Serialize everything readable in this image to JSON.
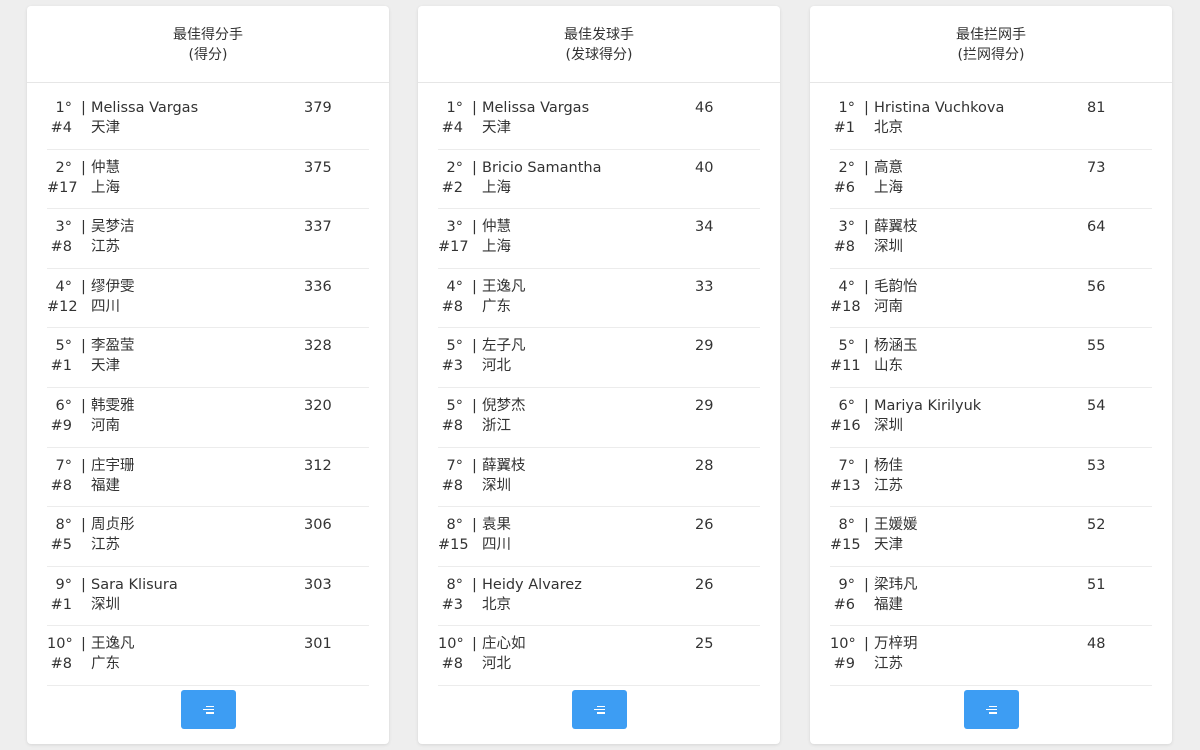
{
  "accent_color": "#3d9df3",
  "panels": [
    {
      "title": "最佳得分手",
      "subtitle": "(得分)",
      "more_icon": "list-icon",
      "rows": [
        {
          "rank": "1°",
          "sep": "|",
          "name": "Melissa Vargas",
          "seed": "#4",
          "city": "天津",
          "value": "379"
        },
        {
          "rank": "2°",
          "sep": "|",
          "name": "仲慧",
          "seed": "#17",
          "city": "上海",
          "value": "375"
        },
        {
          "rank": "3°",
          "sep": "|",
          "name": "吴梦洁",
          "seed": "#8",
          "city": "江苏",
          "value": "337"
        },
        {
          "rank": "4°",
          "sep": "|",
          "name": "缪伊雯",
          "seed": "#12",
          "city": "四川",
          "value": "336"
        },
        {
          "rank": "5°",
          "sep": "|",
          "name": "李盈莹",
          "seed": "#1",
          "city": "天津",
          "value": "328"
        },
        {
          "rank": "6°",
          "sep": "|",
          "name": "韩雯雅",
          "seed": "#9",
          "city": "河南",
          "value": "320"
        },
        {
          "rank": "7°",
          "sep": "|",
          "name": "庄宇珊",
          "seed": "#8",
          "city": "福建",
          "value": "312"
        },
        {
          "rank": "8°",
          "sep": "|",
          "name": "周贞彤",
          "seed": "#5",
          "city": "江苏",
          "value": "306"
        },
        {
          "rank": "9°",
          "sep": "|",
          "name": "Sara Klisura",
          "seed": "#1",
          "city": "深圳",
          "value": "303"
        },
        {
          "rank": "10°",
          "sep": "|",
          "name": "王逸凡",
          "seed": "#8",
          "city": "广东",
          "value": "301"
        }
      ]
    },
    {
      "title": "最佳发球手",
      "subtitle": "(发球得分)",
      "more_icon": "list-icon",
      "rows": [
        {
          "rank": "1°",
          "sep": "|",
          "name": "Melissa Vargas",
          "seed": "#4",
          "city": "天津",
          "value": "46"
        },
        {
          "rank": "2°",
          "sep": "|",
          "name": "Bricio Samantha",
          "seed": "#2",
          "city": "上海",
          "value": "40"
        },
        {
          "rank": "3°",
          "sep": "|",
          "name": "仲慧",
          "seed": "#17",
          "city": "上海",
          "value": "34"
        },
        {
          "rank": "4°",
          "sep": "|",
          "name": "王逸凡",
          "seed": "#8",
          "city": "广东",
          "value": "33"
        },
        {
          "rank": "5°",
          "sep": "|",
          "name": "左子凡",
          "seed": "#3",
          "city": "河北",
          "value": "29"
        },
        {
          "rank": "5°",
          "sep": "|",
          "name": "倪梦杰",
          "seed": "#8",
          "city": "浙江",
          "value": "29"
        },
        {
          "rank": "7°",
          "sep": "|",
          "name": "薛翼枝",
          "seed": "#8",
          "city": "深圳",
          "value": "28"
        },
        {
          "rank": "8°",
          "sep": "|",
          "name": "袁果",
          "seed": "#15",
          "city": "四川",
          "value": "26"
        },
        {
          "rank": "8°",
          "sep": "|",
          "name": "Heidy Alvarez",
          "seed": "#3",
          "city": "北京",
          "value": "26"
        },
        {
          "rank": "10°",
          "sep": "|",
          "name": "庄心如",
          "seed": "#8",
          "city": "河北",
          "value": "25"
        }
      ]
    },
    {
      "title": "最佳拦网手",
      "subtitle": "(拦网得分)",
      "more_icon": "list-icon",
      "rows": [
        {
          "rank": "1°",
          "sep": "|",
          "name": "Hristina Vuchkova",
          "seed": "#1",
          "city": "北京",
          "value": "81"
        },
        {
          "rank": "2°",
          "sep": "|",
          "name": "高意",
          "seed": "#6",
          "city": "上海",
          "value": "73"
        },
        {
          "rank": "3°",
          "sep": "|",
          "name": "薛翼枝",
          "seed": "#8",
          "city": "深圳",
          "value": "64"
        },
        {
          "rank": "4°",
          "sep": "|",
          "name": "毛韵怡",
          "seed": "#18",
          "city": "河南",
          "value": "56"
        },
        {
          "rank": "5°",
          "sep": "|",
          "name": "杨涵玉",
          "seed": "#11",
          "city": "山东",
          "value": "55"
        },
        {
          "rank": "6°",
          "sep": "|",
          "name": "Mariya Kirilyuk",
          "seed": "#16",
          "city": "深圳",
          "value": "54"
        },
        {
          "rank": "7°",
          "sep": "|",
          "name": "杨佳",
          "seed": "#13",
          "city": "江苏",
          "value": "53"
        },
        {
          "rank": "8°",
          "sep": "|",
          "name": "王媛媛",
          "seed": "#15",
          "city": "天津",
          "value": "52"
        },
        {
          "rank": "9°",
          "sep": "|",
          "name": "梁玮凡",
          "seed": "#6",
          "city": "福建",
          "value": "51"
        },
        {
          "rank": "10°",
          "sep": "|",
          "name": "万梓玥",
          "seed": "#9",
          "city": "江苏",
          "value": "48"
        }
      ]
    }
  ]
}
